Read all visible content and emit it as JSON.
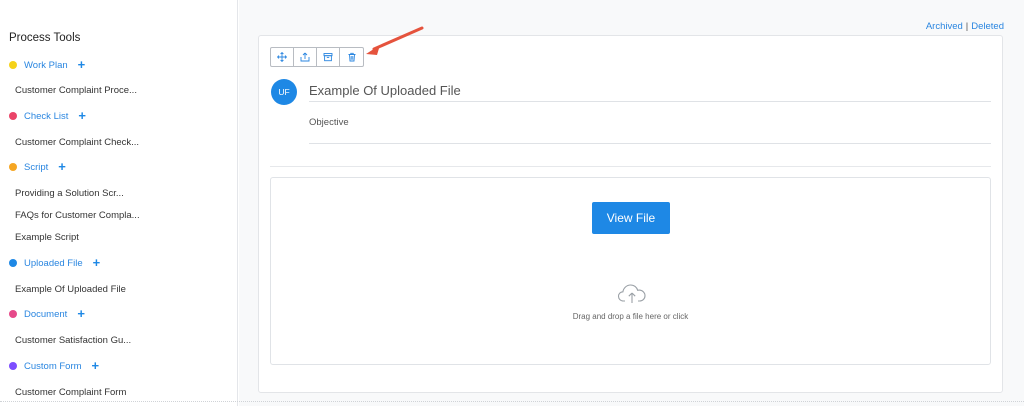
{
  "sidebar": {
    "title": "Process Tools",
    "categories": [
      {
        "label": "Work Plan",
        "color": "#f5d21a",
        "items": [
          "Customer Complaint Proce..."
        ]
      },
      {
        "label": "Check List",
        "color": "#ea4468",
        "items": [
          "Customer Complaint Check..."
        ]
      },
      {
        "label": "Script",
        "color": "#f5a623",
        "items": [
          "Providing a Solution Scr...",
          "FAQs for Customer Compla...",
          "Example Script"
        ]
      },
      {
        "label": "Uploaded File",
        "color": "#1e88e5",
        "items": [
          "Example Of Uploaded File"
        ]
      },
      {
        "label": "Document",
        "color": "#e64a8a",
        "items": [
          "Customer Satisfaction Gu..."
        ]
      },
      {
        "label": "Custom Form",
        "color": "#7c4dff",
        "items": [
          "Customer Complaint Form"
        ]
      }
    ],
    "plus_symbol": "+"
  },
  "top_links": {
    "archived": "Archived",
    "separator": "|",
    "deleted": "Deleted"
  },
  "toolbar": {
    "icons": [
      "move-icon",
      "share-icon",
      "archive-icon",
      "trash-icon"
    ]
  },
  "card": {
    "avatar_initials": "UF",
    "title": "Example Of Uploaded File",
    "objective": "Objective"
  },
  "dropzone": {
    "button_label": "View File",
    "hint": "Drag and drop a file here or click"
  },
  "colors": {
    "accent": "#1e88e5",
    "link": "#2a86e0",
    "arrow": "#e5533d"
  }
}
